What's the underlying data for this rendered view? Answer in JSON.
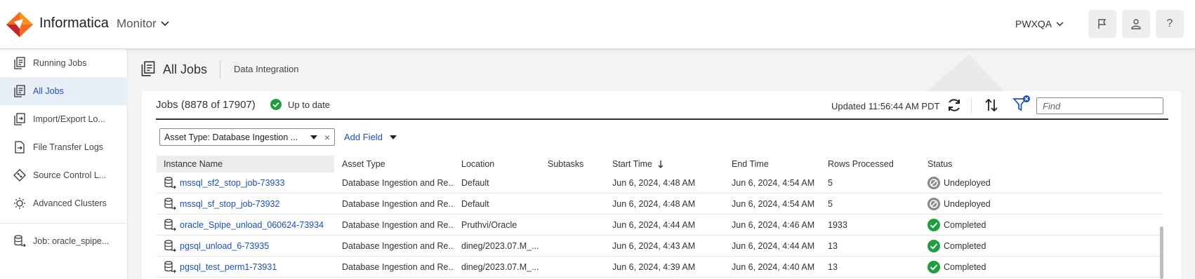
{
  "header": {
    "brand": "Informatica",
    "product": "Monitor",
    "org": "PWXQA",
    "icons": [
      "flag-icon",
      "user-icon",
      "help-icon"
    ],
    "help_glyph": "?"
  },
  "sidebar": {
    "items": [
      {
        "label": "Running Jobs",
        "icon": "jobs-icon"
      },
      {
        "label": "All Jobs",
        "icon": "jobs-icon",
        "active": true
      },
      {
        "label": "Import/Export Lo...",
        "icon": "import-export-icon"
      },
      {
        "label": "File Transfer Logs",
        "icon": "file-transfer-icon"
      },
      {
        "label": "Source Control L...",
        "icon": "source-control-icon"
      },
      {
        "label": "Advanced Clusters",
        "icon": "cluster-icon"
      }
    ],
    "job_item": {
      "label": "Job: oracle_spipe...",
      "icon": "database-job-icon"
    }
  },
  "page": {
    "title": "All Jobs",
    "subtitle": "Data Integration"
  },
  "jobs": {
    "title": "Jobs (8878 of 17907)",
    "status": "Up to date",
    "updated": "Updated 11:56:44 AM PDT",
    "find_placeholder": "Find",
    "filter_chip": "Asset Type: Database Ingestion ...",
    "add_field": "Add Field"
  },
  "table": {
    "columns": [
      "Instance Name",
      "Asset Type",
      "Location",
      "Subtasks",
      "Start Time",
      "End Time",
      "Rows Processed",
      "Status"
    ],
    "sort_column": "Start Time",
    "sort_direction": "descending",
    "rows": [
      {
        "name": "mssql_sf2_stop_job-73933",
        "asset_type": "Database Ingestion and Re...",
        "location": "Default",
        "subtasks": "",
        "start": "Jun 6, 2024, 4:48 AM",
        "end": "Jun 6, 2024, 4:54 AM",
        "rows": "5",
        "status": "Undeployed"
      },
      {
        "name": "mssql_sf_stop_job-73932",
        "asset_type": "Database Ingestion and Re...",
        "location": "Default",
        "subtasks": "",
        "start": "Jun 6, 2024, 4:48 AM",
        "end": "Jun 6, 2024, 4:54 AM",
        "rows": "5",
        "status": "Undeployed"
      },
      {
        "name": "oracle_Spipe_unload_060624-73934",
        "asset_type": "Database Ingestion and Re...",
        "location": "Pruthvi/Oracle",
        "subtasks": "",
        "start": "Jun 6, 2024, 4:44 AM",
        "end": "Jun 6, 2024, 4:46 AM",
        "rows": "1933",
        "status": "Completed"
      },
      {
        "name": "pgsql_unload_6-73935",
        "asset_type": "Database Ingestion and Re...",
        "location": "dineg/2023.07.M_...",
        "subtasks": "",
        "start": "Jun 6, 2024, 4:43 AM",
        "end": "Jun 6, 2024, 4:44 AM",
        "rows": "13",
        "status": "Completed"
      },
      {
        "name": "pgsql_test_perm1-73931",
        "asset_type": "Database Ingestion and Re...",
        "location": "dineg/2023.07.M_...",
        "subtasks": "",
        "start": "Jun 6, 2024, 4:39 AM",
        "end": "Jun 6, 2024, 4:40 AM",
        "rows": "13",
        "status": "Completed"
      }
    ]
  },
  "colors": {
    "accent": "#1c4fb8",
    "completed": "#1e9e3e",
    "undeployed": "#8a8a8a",
    "logo_orange": "#f26b21"
  }
}
